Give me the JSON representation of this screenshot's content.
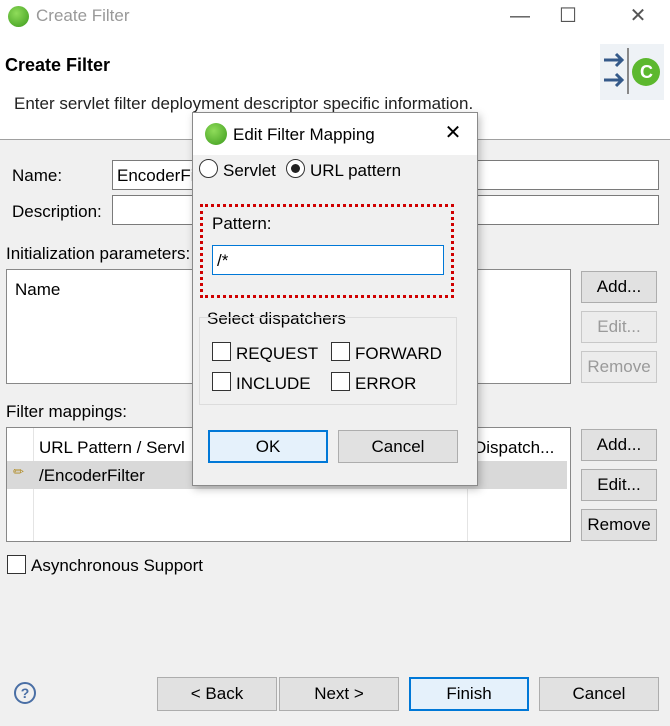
{
  "window": {
    "title": "Create Filter",
    "minimize_icon": "minimize-icon",
    "maximize_icon": "maximize-icon",
    "close_icon": "close-icon"
  },
  "header": {
    "title": "Create Filter",
    "description": "Enter servlet filter deployment descriptor specific information.",
    "banner_icon": "spring-filter-wizard-icon"
  },
  "form": {
    "name_label": "Name:",
    "name_value": "EncoderFilter",
    "description_label": "Description:",
    "description_value": "",
    "init_params_label": "Initialization parameters:",
    "init_params_column": "Name",
    "init_add_label": "Add...",
    "init_edit_label": "Edit...",
    "init_remove_label": "Remove",
    "mappings_label": "Filter mappings:",
    "mappings_columns": [
      "URL Pattern / Servlet Name",
      "Dispatchers"
    ],
    "mappings_col_visible": [
      "URL Pattern / Servl",
      "Dispatch..."
    ],
    "mappings_rows": [
      {
        "icon": "mapping-icon",
        "pattern": "/EncoderFilter",
        "dispatchers": ""
      }
    ],
    "mappings_add_label": "Add...",
    "mappings_edit_label": "Edit...",
    "mappings_remove_label": "Remove",
    "async_label": "Asynchronous Support",
    "async_checked": false
  },
  "footer": {
    "help_icon": "help-icon",
    "back_label": "< Back",
    "next_label": "Next >",
    "finish_label": "Finish",
    "cancel_label": "Cancel"
  },
  "dialog": {
    "title": "Edit Filter Mapping",
    "title_icon": "spring-icon",
    "close_icon": "close-icon",
    "servlet_radio": "Servlet",
    "url_pattern_radio": "URL pattern",
    "selected_mode": "URL pattern",
    "pattern_label": "Pattern:",
    "pattern_value": "/*",
    "dispatchers_label": "Select dispatchers",
    "dispatchers": [
      {
        "label": "REQUEST",
        "checked": false
      },
      {
        "label": "FORWARD",
        "checked": false
      },
      {
        "label": "INCLUDE",
        "checked": false
      },
      {
        "label": "ERROR",
        "checked": false
      }
    ],
    "ok_label": "OK",
    "cancel_label": "Cancel"
  },
  "colors": {
    "highlight_dotted_border": "#d00000",
    "focus_border": "#0078d7",
    "row_selected": "#d9d9d9"
  }
}
